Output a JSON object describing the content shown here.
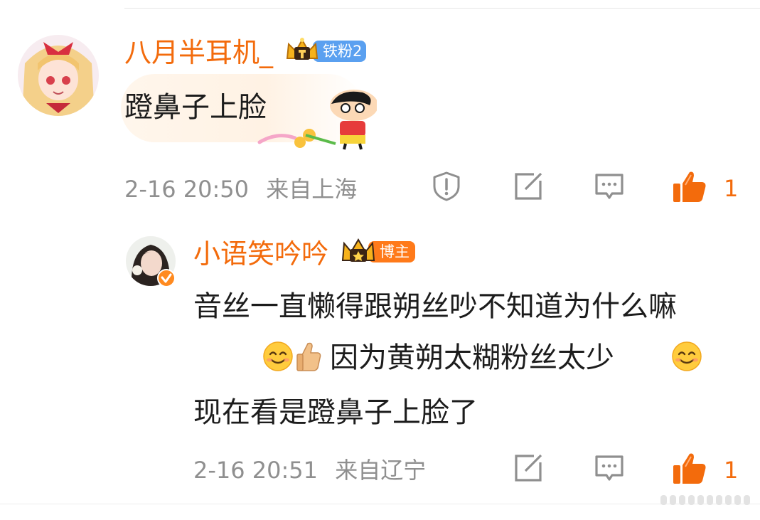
{
  "comment": {
    "username": "八月半耳机_",
    "fan_badge": "铁粉2",
    "text": "蹬鼻子上脸",
    "timestamp": "2-16 20:50",
    "location": "来自上海",
    "likes": "1"
  },
  "reply": {
    "username": "小语笑吟吟",
    "role_badge": "博主",
    "text_1": "音丝一直懒得跟朔丝吵不知道为什么嘛",
    "text_2": "因为黄朔太糊粉丝太少",
    "text_3": "现在看是蹬鼻子上脸了",
    "timestamp": "2-16 20:51",
    "location": "来自辽宁",
    "likes": "1"
  },
  "colors": {
    "accent": "#f36b0c",
    "fan_badge": "#5aa0f0",
    "role_badge": "#ff7a1a",
    "meta": "#8f8f8f",
    "icon": "#8f8f8f"
  },
  "icons": [
    "report-icon",
    "repost-icon",
    "reply-icon",
    "like-icon",
    "smile-emoji-icon",
    "thumbs-up-emoji-icon",
    "crown-badge-icon",
    "verified-icon"
  ]
}
